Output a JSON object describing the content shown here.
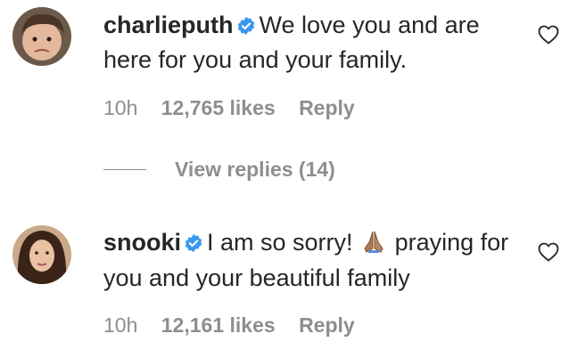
{
  "comments": [
    {
      "username": "charlieputh",
      "text": "We love you and are here for you and your family.",
      "time": "10h",
      "likes": "12,765 likes",
      "reply_label": "Reply",
      "verified": true
    },
    {
      "username": "snooki",
      "text_before": "I am so sorry!",
      "emoji": "folded-hands-emoji",
      "text_after": "praying for you and your beautiful family",
      "time": "10h",
      "likes": "12,161 likes",
      "reply_label": "Reply",
      "verified": true
    }
  ],
  "view_replies": "View replies (14)",
  "colors": {
    "text": "#262626",
    "muted": "#8e8e8e",
    "verified_blue": "#3897f0"
  },
  "icons": {
    "verified": "verified-badge-icon",
    "like": "heart-outline-icon"
  }
}
